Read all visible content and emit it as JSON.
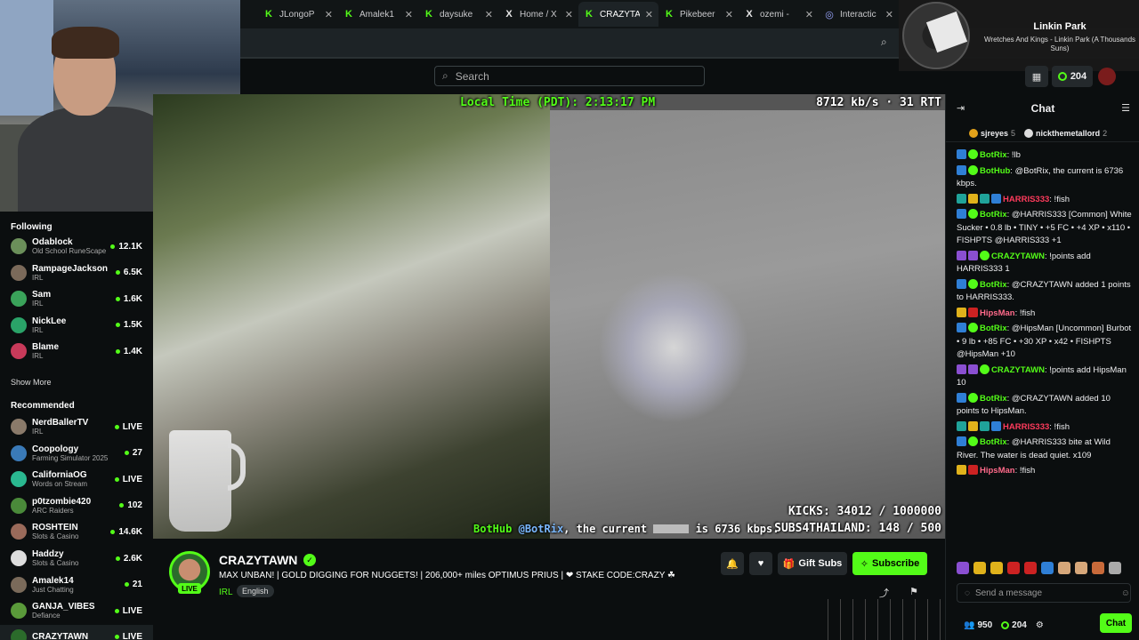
{
  "browser": {
    "tabs": [
      {
        "favicon": "K",
        "favicon_kind": "kick",
        "title": "JLongoP",
        "active": false
      },
      {
        "favicon": "K",
        "favicon_kind": "kick",
        "title": "Amalek1",
        "active": false
      },
      {
        "favicon": "K",
        "favicon_kind": "kick",
        "title": "daysuke",
        "active": false
      },
      {
        "favicon": "X",
        "favicon_kind": "x",
        "title": "Home / X",
        "active": false
      },
      {
        "favicon": "K",
        "favicon_kind": "kick",
        "title": "CRAZYTA",
        "active": true
      },
      {
        "favicon": "K",
        "favicon_kind": "kick",
        "title": "Pikebeer",
        "active": false
      },
      {
        "favicon": "X",
        "favicon_kind": "x",
        "title": "ozemi - ",
        "active": false
      },
      {
        "favicon": "◎",
        "favicon_kind": "globe",
        "title": "Interactic",
        "active": false
      }
    ]
  },
  "now_playing": {
    "artist": "Linkin Park",
    "track": "Wretches And Kings - Linkin Park (A Thousands Suns)"
  },
  "header": {
    "search_placeholder": "Search",
    "points": "204"
  },
  "sidebar": {
    "following_heading": "Following",
    "following": [
      {
        "name": "Odablock",
        "category": "Old School RuneScape",
        "viewers": "12.1K",
        "avatar_color": "#6b8f5a"
      },
      {
        "name": "RampageJackson",
        "category": "IRL",
        "viewers": "6.5K",
        "avatar_color": "#7b6a5a"
      },
      {
        "name": "Sam",
        "category": "IRL",
        "viewers": "1.6K",
        "avatar_color": "#3aa35a"
      },
      {
        "name": "NickLee",
        "category": "IRL",
        "viewers": "1.5K",
        "avatar_color": "#2aa368"
      },
      {
        "name": "Blame",
        "category": "IRL",
        "viewers": "1.4K",
        "avatar_color": "#c83a5a"
      }
    ],
    "show_more": "Show More",
    "recommended_heading": "Recommended",
    "recommended": [
      {
        "name": "NerdBallerTV",
        "category": "IRL",
        "viewers": "LIVE",
        "avatar_color": "#8a7a6a"
      },
      {
        "name": "Coopology",
        "category": "Farming Simulator 2025",
        "viewers": "27",
        "avatar_color": "#3a7ab8"
      },
      {
        "name": "CaliforniaOG",
        "category": "Words on Stream",
        "viewers": "LIVE",
        "avatar_color": "#2ab890"
      },
      {
        "name": "p0tzombie420",
        "category": "ARC Raiders",
        "viewers": "102",
        "avatar_color": "#4a8a3a"
      },
      {
        "name": "ROSHTEIN",
        "category": "Slots & Casino",
        "viewers": "14.6K",
        "avatar_color": "#9a6a5a"
      },
      {
        "name": "Haddzy",
        "category": "Slots & Casino",
        "viewers": "2.6K",
        "avatar_color": "#ddd"
      },
      {
        "name": "Amalek14",
        "category": "Just Chatting",
        "viewers": "21",
        "avatar_color": "#7a6a5a"
      },
      {
        "name": "GANJA_VIBES",
        "category": "Defiance",
        "viewers": "LIVE",
        "avatar_color": "#5a9a3a"
      },
      {
        "name": "CRAZYTAWN",
        "category": "",
        "viewers": "LIVE",
        "avatar_color": "#2b6b2b"
      }
    ]
  },
  "video": {
    "local_time": "Local Time (PDT): 2:13:17 PM",
    "bitrate": "8712 kb/s · 31 RTT",
    "kicks": "KICKS: 34012 / 1000000",
    "subs": "SUBS4THAILAND: 148 / 500",
    "ticker_name": "BotHub",
    "ticker_mention": "@BotRix",
    "ticker_text_a": ", the current",
    "ticker_text_b": "is 6736 kbps."
  },
  "stream": {
    "live_badge": "LIVE",
    "streamer": "CRAZYTAWN",
    "title": "MAX UNBAN! | GOLD DIGGING FOR NUGGETS! | 206,000+ miles OPTIMUS PRIUS | ❤ STAKE CODE:CRAZY ☘",
    "category": "IRL",
    "language": "English",
    "gift_label": "Gift Subs",
    "subscribe_label": "Subscribe"
  },
  "chat": {
    "title": "Chat",
    "pinned": [
      {
        "name": "sjreyes",
        "count": "5"
      },
      {
        "name": "nickthemetallord",
        "count": "2"
      }
    ],
    "messages": [
      {
        "user": "BotRix",
        "color": "#53fc18",
        "text": ": !lb"
      },
      {
        "user": "BotHub",
        "color": "#53fc18",
        "text": ": @BotRix, the current is 6736 kbps."
      },
      {
        "user": "HARRIS333",
        "color": "#ff3b5c",
        "text": ": !fish"
      },
      {
        "user": "BotRix",
        "color": "#53fc18",
        "text": ": @HARRIS333 [Common] White Sucker • 0.8 lb • TINY • +5 FC • +4 XP • x110 • FISHPTS @HARRIS333 +1"
      },
      {
        "user": "CRAZYTAWN",
        "color": "#53fc18",
        "text": ": !points add HARRIS333 1"
      },
      {
        "user": "BotRix",
        "color": "#53fc18",
        "text": ": @CRAZYTAWN added 1 points to HARRIS333."
      },
      {
        "user": "HipsMan",
        "color": "#ff6a8a",
        "text": ": !fish"
      },
      {
        "user": "BotRix",
        "color": "#53fc18",
        "text": ": @HipsMan [Uncommon] Burbot • 9 lb • +85 FC • +30 XP • x42 • FISHPTS @HipsMan +10"
      },
      {
        "user": "CRAZYTAWN",
        "color": "#53fc18",
        "text": ": !points add HipsMan 10"
      },
      {
        "user": "BotRix",
        "color": "#53fc18",
        "text": ": @CRAZYTAWN added 10 points to HipsMan."
      },
      {
        "user": "HARRIS333",
        "color": "#ff3b5c",
        "text": ": !fish"
      },
      {
        "user": "BotRix",
        "color": "#53fc18",
        "text": ": @HARRIS333 bite at Wild River. The water is dead quiet. x109"
      },
      {
        "user": "HipsMan",
        "color": "#ff6a8a",
        "text": ": !fish"
      }
    ],
    "input_placeholder": "Send a message",
    "footer_count": "950",
    "footer_points": "204",
    "send_label": "Chat"
  }
}
